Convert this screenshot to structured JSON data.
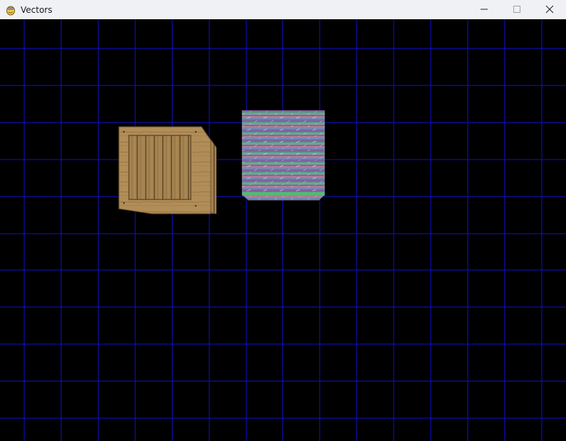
{
  "window": {
    "title": "Vectors",
    "icon": "pygame-snake-icon",
    "controls": [
      "minimize-icon",
      "maximize-icon",
      "close-icon"
    ]
  },
  "scene": {
    "background_color": "#000000",
    "grid_color": "#1010d8",
    "objects": [
      {
        "name": "wooden-crate",
        "texture": "wood-crate"
      },
      {
        "name": "striped-noise-cube",
        "texture": "rainbow-stripes"
      }
    ]
  }
}
